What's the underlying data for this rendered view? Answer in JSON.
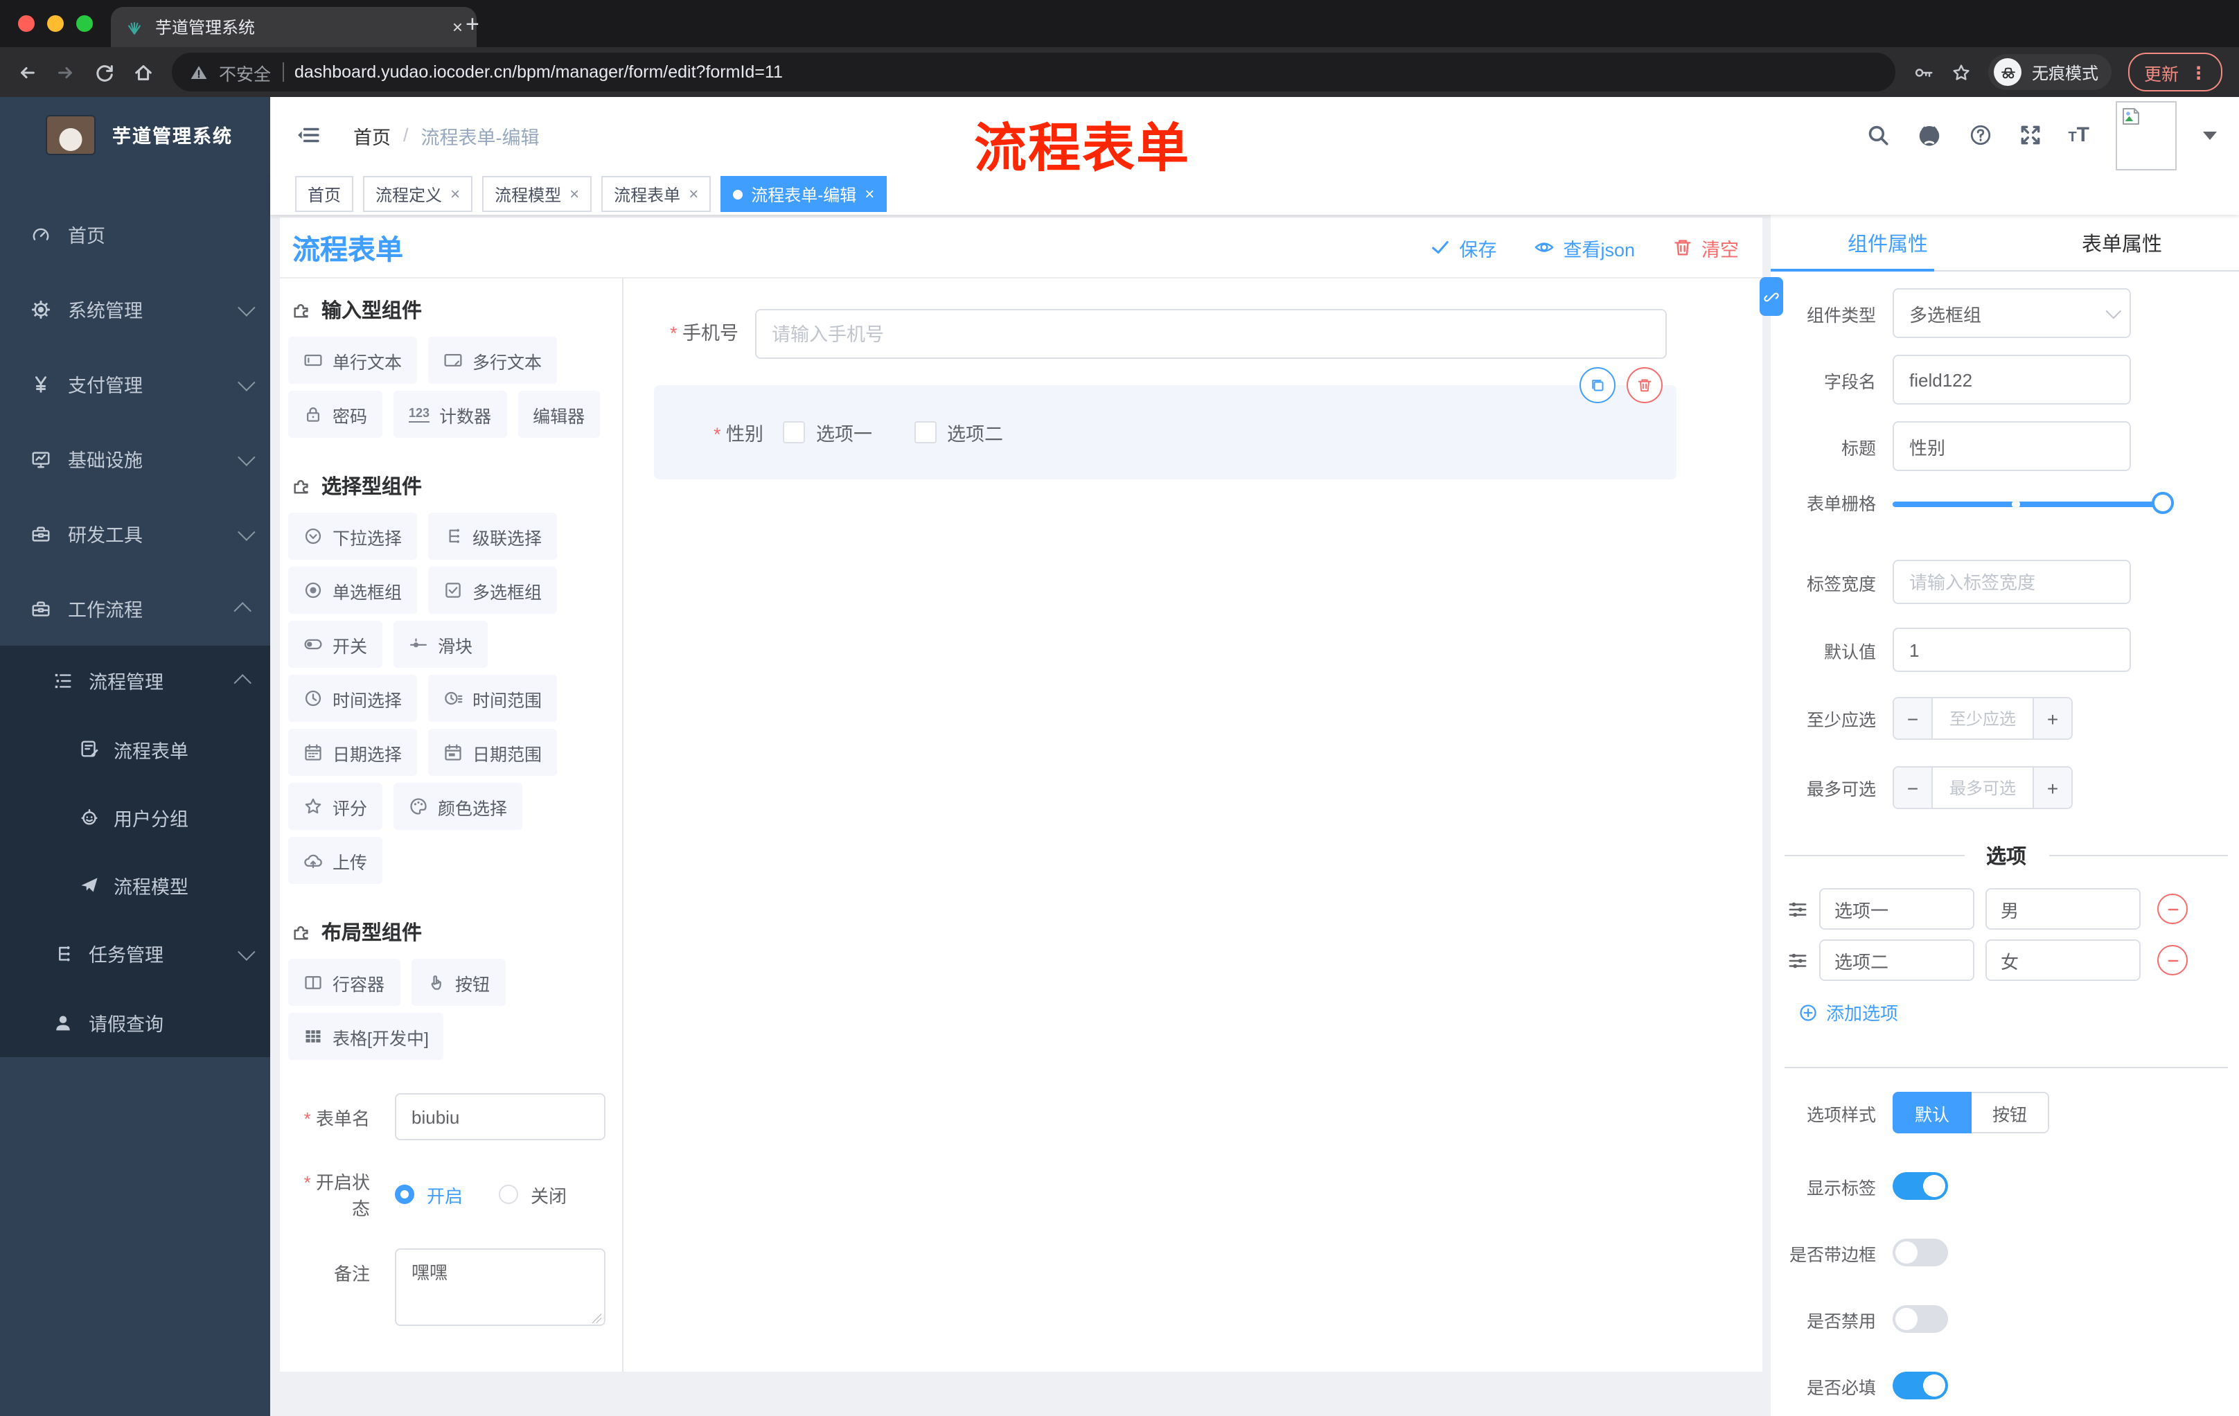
{
  "colors": {
    "accent": "#409eff",
    "danger": "#f56c6c",
    "watermark_red": "#ff2702",
    "sidebar_bg": "#304156"
  },
  "browser": {
    "tab_title": "芋道管理系统",
    "security_label": "不安全",
    "url": "dashboard.yudao.iocoder.cn/bpm/manager/form/edit?formId=11",
    "incognito_label": "无痕模式",
    "update_label": "更新"
  },
  "sidebar": {
    "app_title": "芋道管理系统",
    "menu": [
      {
        "label": "首页",
        "icon": "dashboard-icon"
      },
      {
        "label": "系统管理",
        "icon": "gear-icon"
      },
      {
        "label": "支付管理",
        "icon": "yen-icon"
      },
      {
        "label": "基础设施",
        "icon": "monitor-icon"
      },
      {
        "label": "研发工具",
        "icon": "toolbox-icon"
      },
      {
        "label": "工作流程",
        "icon": "toolbox-icon"
      }
    ],
    "submenu": {
      "group_label": "流程管理",
      "children": [
        {
          "label": "流程表单",
          "icon": "document-edit-icon"
        },
        {
          "label": "用户分组",
          "icon": "robot-icon"
        },
        {
          "label": "流程模型",
          "icon": "paper-plane-icon"
        }
      ],
      "task_label": "任务管理",
      "leave_label": "请假查询"
    }
  },
  "header": {
    "breadcrumb_home": "首页",
    "breadcrumb_current": "流程表单-编辑",
    "watermark": "流程表单"
  },
  "tags": {
    "items": [
      {
        "label": "首页",
        "closable": false,
        "active": false
      },
      {
        "label": "流程定义",
        "closable": true,
        "active": false
      },
      {
        "label": "流程模型",
        "closable": true,
        "active": false
      },
      {
        "label": "流程表单",
        "closable": true,
        "active": false
      },
      {
        "label": "流程表单-编辑",
        "closable": true,
        "active": true
      }
    ]
  },
  "designer": {
    "title": "流程表单",
    "toolbar": {
      "save": "保存",
      "view_json": "查看json",
      "clear": "清空"
    },
    "palette": {
      "sections": [
        {
          "title": "输入型组件",
          "items": [
            {
              "label": "单行文本",
              "icon": "text-input-icon"
            },
            {
              "label": "多行文本",
              "icon": "textarea-icon"
            },
            {
              "label": "密码",
              "icon": "lock-icon"
            },
            {
              "label": "计数器",
              "icon": "counter-123-icon"
            },
            {
              "label": "编辑器",
              "icon": "none"
            }
          ]
        },
        {
          "title": "选择型组件",
          "items": [
            {
              "label": "下拉选择",
              "icon": "select-icon"
            },
            {
              "label": "级联选择",
              "icon": "cascader-icon"
            },
            {
              "label": "单选框组",
              "icon": "radio-icon"
            },
            {
              "label": "多选框组",
              "icon": "checkbox-icon"
            },
            {
              "label": "开关",
              "icon": "switch-icon"
            },
            {
              "label": "滑块",
              "icon": "slider-icon"
            },
            {
              "label": "时间选择",
              "icon": "clock-icon"
            },
            {
              "label": "时间范围",
              "icon": "time-range-icon"
            },
            {
              "label": "日期选择",
              "icon": "calendar-icon"
            },
            {
              "label": "日期范围",
              "icon": "calendar-range-icon"
            },
            {
              "label": "评分",
              "icon": "star-icon"
            },
            {
              "label": "颜色选择",
              "icon": "palette-icon"
            },
            {
              "label": "上传",
              "icon": "cloud-upload-icon"
            }
          ]
        },
        {
          "title": "布局型组件",
          "items": [
            {
              "label": "行容器",
              "icon": "columns-icon"
            },
            {
              "label": "按钮",
              "icon": "hand-click-icon"
            },
            {
              "label": "表格[开发中]",
              "icon": "table-icon"
            }
          ]
        }
      ]
    },
    "form": {
      "name_label": "表单名",
      "name_value": "biubiu",
      "status_label": "开启状态",
      "status_on": "开启",
      "status_off": "关闭",
      "status_selected": "开启",
      "remark_label": "备注",
      "remark_value": "嘿嘿"
    },
    "canvas": {
      "phone": {
        "label": "手机号",
        "placeholder": "请输入手机号",
        "required": true
      },
      "gender": {
        "label": "性别",
        "required": true,
        "option1": "选项一",
        "option2": "选项二"
      }
    }
  },
  "props": {
    "tab_component": "组件属性",
    "tab_form": "表单属性",
    "component_type": {
      "label": "组件类型",
      "value": "多选框组"
    },
    "field_name": {
      "label": "字段名",
      "value": "field122"
    },
    "title": {
      "label": "标题",
      "value": "性别"
    },
    "grid": {
      "label": "表单栅格"
    },
    "label_width": {
      "label": "标签宽度",
      "placeholder": "请输入标签宽度"
    },
    "default_value": {
      "label": "默认值",
      "value": "1"
    },
    "min_select": {
      "label": "至少应选",
      "placeholder": "至少应选"
    },
    "max_select": {
      "label": "最多可选",
      "placeholder": "最多可选"
    },
    "options_title": "选项",
    "options": [
      {
        "label": "选项一",
        "value": "男"
      },
      {
        "label": "选项二",
        "value": "女"
      }
    ],
    "add_option": "添加选项",
    "option_style": {
      "label": "选项样式",
      "default_choice": "默认",
      "button_choice": "按钮",
      "selected": "默认"
    },
    "toggles": [
      {
        "label": "显示标签",
        "on": true
      },
      {
        "label": "是否带边框",
        "on": false
      },
      {
        "label": "是否禁用",
        "on": false
      },
      {
        "label": "是否必填",
        "on": true
      }
    ]
  }
}
